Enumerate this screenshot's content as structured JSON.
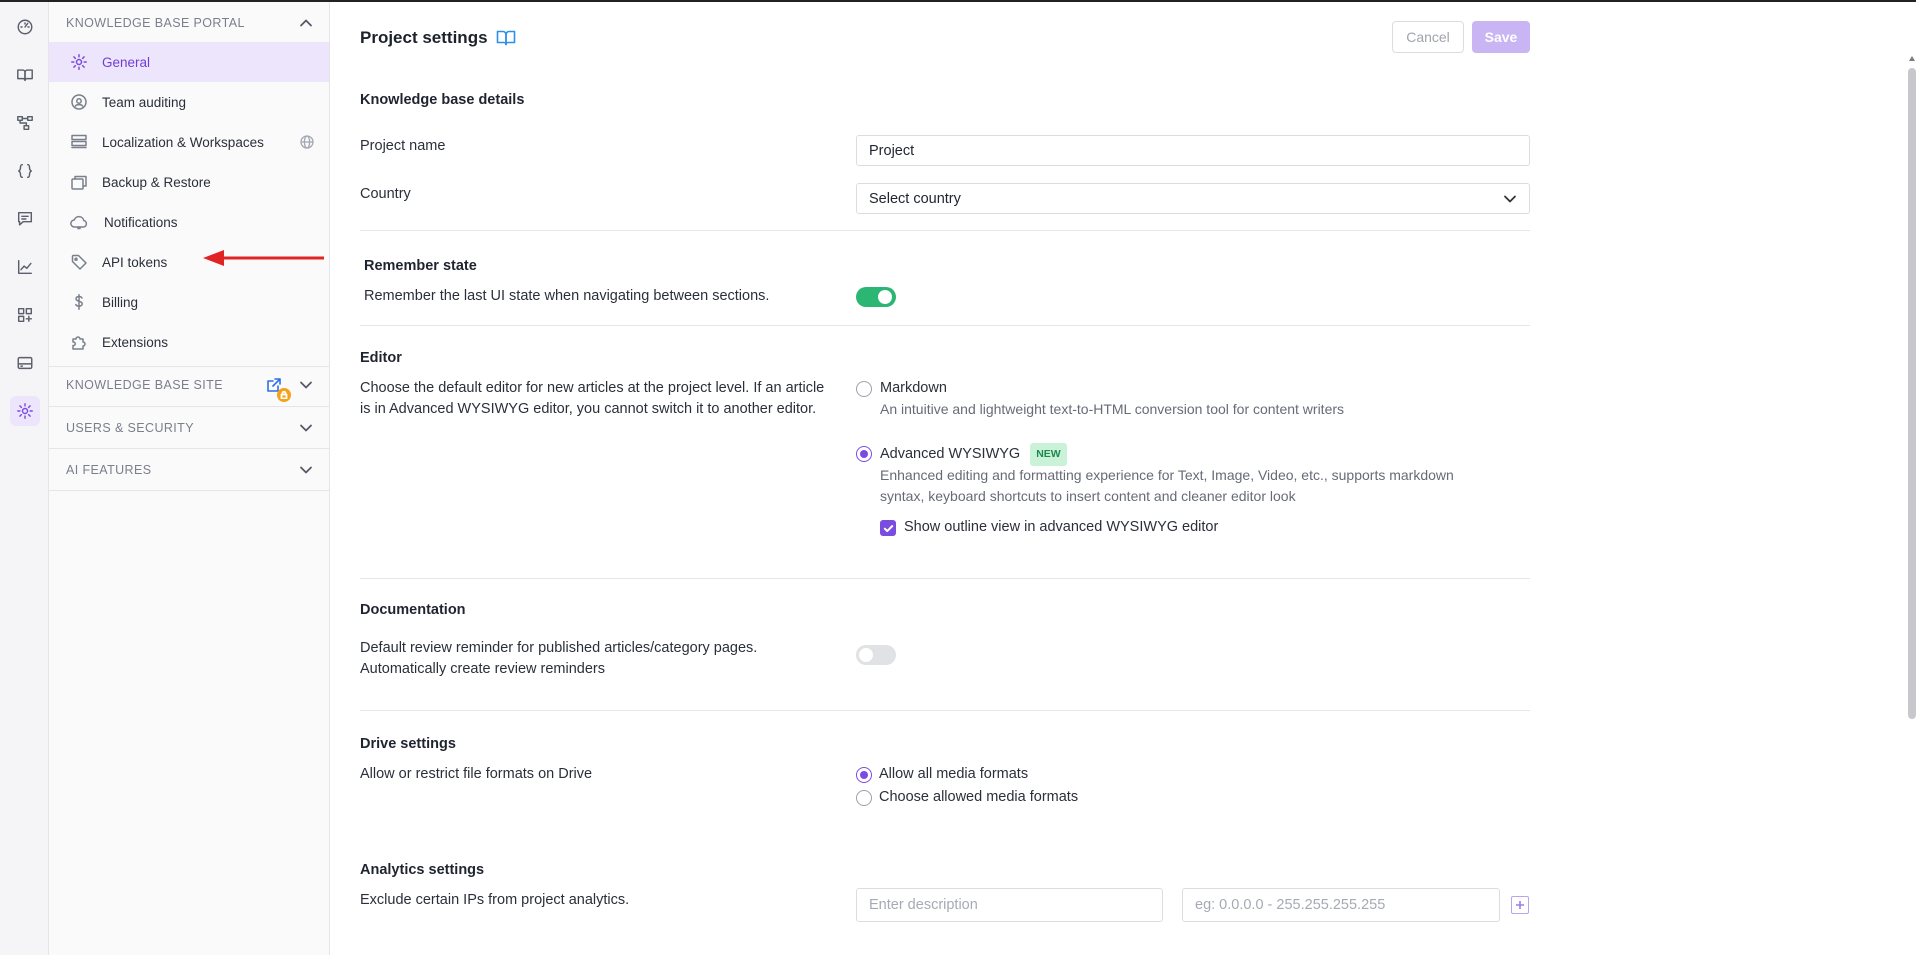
{
  "sidebar": {
    "sections": [
      {
        "label": "KNOWLEDGE BASE PORTAL"
      },
      {
        "label": "KNOWLEDGE BASE SITE"
      },
      {
        "label": "USERS & SECURITY"
      },
      {
        "label": "AI FEATURES"
      }
    ],
    "items": [
      {
        "label": "General",
        "icon": "gear-icon"
      },
      {
        "label": "Team auditing",
        "icon": "audit-icon"
      },
      {
        "label": "Localization & Workspaces",
        "icon": "layers-icon"
      },
      {
        "label": "Backup & Restore",
        "icon": "backup-icon"
      },
      {
        "label": "Notifications",
        "icon": "cloud-bell-icon"
      },
      {
        "label": "API tokens",
        "icon": "tag-icon"
      },
      {
        "label": "Billing",
        "icon": "dollar-icon"
      },
      {
        "label": "Extensions",
        "icon": "puzzle-icon"
      }
    ]
  },
  "header": {
    "title": "Project settings",
    "cancel_label": "Cancel",
    "save_label": "Save"
  },
  "kb_details": {
    "heading": "Knowledge base details",
    "project_name_label": "Project name",
    "project_name_value": "Project",
    "country_label": "Country",
    "country_value": "Select country"
  },
  "remember_state": {
    "heading": "Remember state",
    "description": "Remember the last UI state when navigating between sections.",
    "enabled": true
  },
  "editor": {
    "heading": "Editor",
    "description_line1": "Choose the default editor for new articles at the project level. If an article",
    "description_line2": "is in Advanced WYSIWYG editor, you cannot switch it to another editor.",
    "markdown_label": "Markdown",
    "markdown_desc": "An intuitive and lightweight text-to-HTML conversion tool for content writers",
    "wysiwyg_label": "Advanced WYSIWYG",
    "wysiwyg_badge": "NEW",
    "wysiwyg_desc_line1": "Enhanced editing and formatting experience for Text, Image, Video, etc., supports markdown",
    "wysiwyg_desc_line2": "syntax, keyboard shortcuts to insert content and cleaner editor look",
    "outline_label": "Show outline view in advanced WYSIWYG editor",
    "selected": "Advanced WYSIWYG"
  },
  "documentation": {
    "heading": "Documentation",
    "line1": "Default review reminder for published articles/category pages.",
    "line2": "Automatically create review reminders",
    "enabled": false
  },
  "drive": {
    "heading": "Drive settings",
    "description": "Allow or restrict file formats on Drive",
    "option_all": "Allow all media formats",
    "option_choose": "Choose allowed media formats",
    "selected": "Allow all media formats"
  },
  "analytics": {
    "heading": "Analytics settings",
    "description": "Exclude certain IPs from project analytics.",
    "desc_placeholder": "Enter description",
    "ip_placeholder": "eg: 0.0.0.0 - 255.255.255.255"
  },
  "colors": {
    "accent": "#7b4ce0",
    "toggle_on": "#2bb673",
    "annotation_arrow": "#e02424"
  }
}
